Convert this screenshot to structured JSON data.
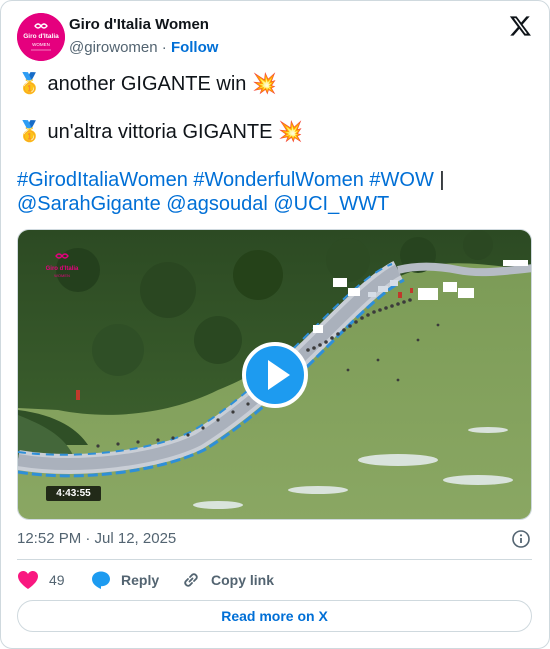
{
  "author": {
    "name": "Giro d'Italia Women",
    "handle": "@girowomen",
    "separator": "·",
    "follow_label": "Follow",
    "avatar_logo_text": "Giro d'Italia WOMEN"
  },
  "tweet": {
    "line1": "🥇 another GIGANTE win 💥",
    "line2": "🥇 un'altra vittoria GIGANTE 💥",
    "hashtags": [
      "#GirodItaliaWomen",
      "#WonderfulWomen",
      "#WOW"
    ],
    "pipe": "|",
    "mentions": [
      "@SarahGigante",
      "@agsoudal",
      "@UCI_WWT"
    ]
  },
  "media": {
    "duration": "4:43:55",
    "overlay_logo_text": "Giro d'Italia WOMEN"
  },
  "meta": {
    "timestamp": "12:52 PM · Jul 12, 2025"
  },
  "actions": {
    "likes_count": "49",
    "reply_label": "Reply",
    "copy_link_label": "Copy link"
  },
  "read_more_label": "Read more on X",
  "colors": {
    "brand_pink": "#e5007e",
    "link_blue": "#006fd6",
    "play_blue": "#1d9bf0",
    "like_pink": "#f91880",
    "reply_blue": "#1d9bf0"
  }
}
